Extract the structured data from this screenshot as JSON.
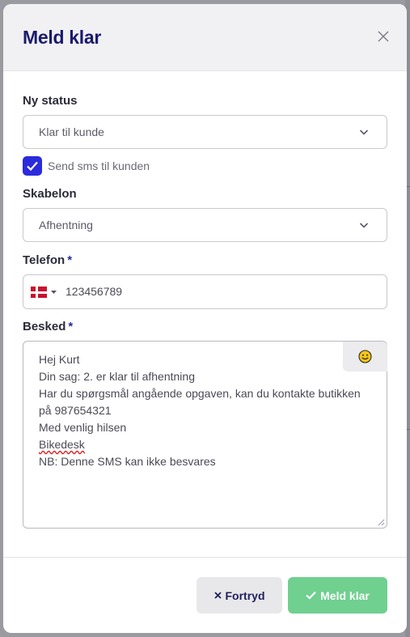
{
  "modal": {
    "title": "Meld klar",
    "close_icon": "close-icon"
  },
  "status": {
    "label": "Ny status",
    "value": "Klar til kunde"
  },
  "sms": {
    "checked": true,
    "label": "Send sms til kunden"
  },
  "template": {
    "label": "Skabelon",
    "value": "Afhentning"
  },
  "phone": {
    "label": "Telefon",
    "required_mark": "*",
    "country": "DK",
    "value": "123456789"
  },
  "message": {
    "label": "Besked",
    "required_mark": "*",
    "lines": [
      "Hej Kurt",
      "Din sag: 2. er klar til afhentning",
      "Har du spørgsmål angående opgaven, kan du kontakte butikken på 987654321",
      "Med venlig hilsen",
      "Bikedesk",
      "NB: Denne SMS kan ikke besvares"
    ],
    "emoji_icon": "smiley-icon"
  },
  "footer": {
    "cancel_label": "Fortryd",
    "confirm_label": "Meld klar"
  },
  "colors": {
    "title": "#1a1a6e",
    "checkbox": "#2b2bdc",
    "confirm": "#6fd08f",
    "cancel_bg": "#e8e8ea"
  }
}
